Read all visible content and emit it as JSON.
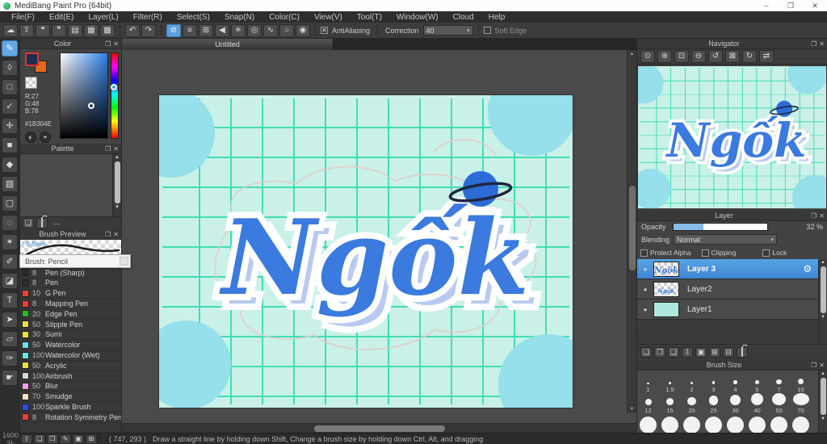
{
  "window": {
    "title": "MediBang Paint Pro (64bit)"
  },
  "icons": {
    "minimize": "–",
    "maximize": "❐",
    "close": "✕",
    "panel_float": "❐",
    "panel_close": "✕",
    "scroll_up": "▲",
    "scroll_down": "▼",
    "gear": "⚙",
    "dropdown": "▾",
    "visibility": "●",
    "check": "✕",
    "dash": "—"
  },
  "menu": {
    "items": [
      "File(F)",
      "Edit(E)",
      "Layer(L)",
      "Filter(R)",
      "Select(S)",
      "Snap(N)",
      "Color(C)",
      "View(V)",
      "Tool(T)",
      "Window(W)",
      "Cloud",
      "Help"
    ]
  },
  "toolbar": {
    "file_buttons": [
      {
        "name": "cloud-save-button",
        "glyph": "☁"
      },
      {
        "name": "upload-button",
        "glyph": "⇧"
      },
      {
        "name": "comment-button",
        "glyph": "❝"
      },
      {
        "name": "chat-button",
        "glyph": "❞"
      },
      {
        "name": "document-button",
        "glyph": "▤"
      },
      {
        "name": "layout-panels-button",
        "glyph": "▦"
      },
      {
        "name": "tile-panels-button",
        "glyph": "▩"
      }
    ],
    "history_buttons": [
      {
        "name": "undo-button",
        "glyph": "↶"
      },
      {
        "name": "redo-button",
        "glyph": "↷"
      }
    ],
    "snap_buttons": [
      {
        "name": "snap-off-button",
        "glyph": "⊘",
        "selected": true
      },
      {
        "name": "parallel-snap-button",
        "glyph": "≡"
      },
      {
        "name": "cross-snap-button",
        "glyph": "⊞"
      },
      {
        "name": "vanishing-point-snap-button",
        "glyph": "◀"
      },
      {
        "name": "radial-snap-button",
        "glyph": "✳"
      },
      {
        "name": "concentric-circle-snap-button",
        "glyph": "◎"
      },
      {
        "name": "curve-snap-button",
        "glyph": "∿"
      },
      {
        "name": "ellipse-snap-button",
        "glyph": "○"
      },
      {
        "name": "snap-settings-button",
        "glyph": "◉"
      }
    ],
    "antialiasing_label": "AntiAliasing",
    "correction_label": "Correction",
    "correction_value": "40",
    "soft_edge_label": "Soft Edge"
  },
  "tools": [
    {
      "name": "tool-brush",
      "glyph": "✎",
      "selected": true
    },
    {
      "name": "tool-eraser",
      "glyph": "◊"
    },
    {
      "name": "tool-shape-brush",
      "glyph": "□"
    },
    {
      "name": "tool-dot-pen",
      "glyph": "✓"
    },
    {
      "name": "tool-move",
      "glyph": "✛"
    },
    {
      "name": "tool-fill-rect",
      "glyph": "■"
    },
    {
      "name": "tool-bucket",
      "glyph": "◆"
    },
    {
      "name": "tool-gradient",
      "glyph": "▧"
    },
    {
      "name": "tool-select",
      "glyph": "▢"
    },
    {
      "name": "tool-lasso",
      "glyph": "◌"
    },
    {
      "name": "tool-magic-wand",
      "glyph": "✶"
    },
    {
      "name": "tool-select-pen",
      "glyph": "✐"
    },
    {
      "name": "tool-select-eraser",
      "glyph": "◪"
    },
    {
      "name": "tool-text",
      "glyph": "T"
    },
    {
      "name": "tool-operation",
      "glyph": "➤"
    },
    {
      "name": "tool-eraser-soft",
      "glyph": "▱"
    },
    {
      "name": "tool-eyedropper",
      "glyph": "✑"
    },
    {
      "name": "tool-hand",
      "glyph": "☛"
    }
  ],
  "color_panel": {
    "title": "Color",
    "r": "R:27",
    "g": "G:48",
    "b": "B:78",
    "hex": "#1B304E",
    "fg_color": "#1b304e",
    "bg_color": "#e8671c",
    "buttons": [
      {
        "name": "color-wheel-button",
        "glyph": "◐"
      },
      {
        "name": "color-mode-button",
        "glyph": "◓"
      }
    ]
  },
  "palette_panel": {
    "title": "Palette",
    "empty_label": "—"
  },
  "brush_preview": {
    "title": "Brush Preview",
    "size_label": "* 0.5mm",
    "tooltip": "Brush: Pencil"
  },
  "brushes": {
    "items": [
      {
        "size": "7",
        "name": "Pencil",
        "color": "#2a2a2a",
        "selected": true
      },
      {
        "size": "8",
        "name": "Pen (Sharp)",
        "color": "#2a2a2a"
      },
      {
        "size": "8",
        "name": "Pen",
        "color": "#2a2a2a"
      },
      {
        "size": "10",
        "name": "G Pen",
        "color": "#e8413c"
      },
      {
        "size": "8",
        "name": "Mapping Pen",
        "color": "#e8413c"
      },
      {
        "size": "20",
        "name": "Edge Pen",
        "color": "#2fb52f"
      },
      {
        "size": "50",
        "name": "Stipple Pen",
        "color": "#e8e23c"
      },
      {
        "size": "30",
        "name": "Sumi",
        "color": "#e8e23c"
      },
      {
        "size": "50",
        "name": "Watercolor",
        "color": "#6fe0e8"
      },
      {
        "size": "100",
        "name": "Watercolor (Wet)",
        "color": "#6fe0e8"
      },
      {
        "size": "50",
        "name": "Acrylic",
        "color": "#e8e23c"
      },
      {
        "size": "100",
        "name": "Airbrush",
        "color": "#d8d8d8"
      },
      {
        "size": "50",
        "name": "Blur",
        "color": "#f0a0e8"
      },
      {
        "size": "70",
        "name": "Smudge",
        "color": "#f8dfc8"
      },
      {
        "size": "100",
        "name": "Sparkle Brush",
        "color": "#2f4fe0"
      },
      {
        "size": "8",
        "name": "Rotation Symmetry Pen",
        "color": "#e8413c"
      }
    ]
  },
  "canvas": {
    "tab_title": "Untitled",
    "artwork_text": "Ngốk"
  },
  "navigator": {
    "title": "Navigator",
    "buttons": [
      {
        "name": "nav-zoom-button",
        "glyph": "⊙"
      },
      {
        "name": "nav-zoom-in-button",
        "glyph": "⊕"
      },
      {
        "name": "nav-fit-screen-button",
        "glyph": "⊡"
      },
      {
        "name": "nav-zoom-out-button",
        "glyph": "⊖"
      },
      {
        "name": "nav-rotate-left-button",
        "glyph": "↺"
      },
      {
        "name": "nav-reset-view-button",
        "glyph": "⊠"
      },
      {
        "name": "nav-rotate-right-button",
        "glyph": "↻"
      },
      {
        "name": "nav-flip-button",
        "glyph": "⇄"
      }
    ]
  },
  "layer_panel": {
    "title": "Layer",
    "opacity_label": "Opacity",
    "opacity_value": "32 %",
    "opacity_percent": 32,
    "blending_label": "Blending",
    "blending_value": "Normal",
    "check_labels": [
      "Protect Alpha",
      "Clipping",
      "Lock"
    ],
    "layers": [
      {
        "name": "Layer 3",
        "thumb": "l3",
        "selected": true
      },
      {
        "name": "Layer2",
        "thumb": "l2"
      },
      {
        "name": "Layer1",
        "thumb": "l1"
      }
    ],
    "buttons": [
      {
        "name": "new-layer-button",
        "glyph": "❏"
      },
      {
        "name": "new-8bit-layer-button",
        "glyph": "❐"
      },
      {
        "name": "new-1bit-layer-button",
        "glyph": "❑"
      },
      {
        "name": "import-layer-button",
        "glyph": "⇩"
      },
      {
        "name": "layer-folder-button",
        "glyph": "▣"
      },
      {
        "name": "duplicate-layer-button",
        "glyph": "⊞"
      },
      {
        "name": "merge-layer-button",
        "glyph": "⊟"
      },
      {
        "name": "delete-layer-button",
        "glyph": ""
      }
    ]
  },
  "brush_size_panel": {
    "title": "Brush Size",
    "row1": [
      "1",
      "1.5",
      "2",
      "3",
      "4",
      "5",
      "7",
      "10"
    ],
    "row2": [
      "12",
      "15",
      "20",
      "25",
      "30",
      "40",
      "50",
      "70"
    ]
  },
  "status_bar": {
    "zoom": "1600 %",
    "buttons": [
      {
        "name": "upload-brush-button",
        "glyph": "⇧"
      },
      {
        "name": "new-brush-button",
        "glyph": "❏"
      },
      {
        "name": "new-brush-menu-button",
        "glyph": "❐"
      },
      {
        "name": "edit-brush-button",
        "glyph": "✎"
      },
      {
        "name": "brush-folder-button",
        "glyph": "▣"
      },
      {
        "name": "duplicate-brush-button",
        "glyph": "⊞"
      }
    ],
    "coordinates": "( 747, 293 )",
    "hint": "Draw a straight line by holding down Shift, Change a brush size by holding down Ctrl, Alt, and dragging"
  },
  "colors": {
    "accent": "#4d9fdb",
    "foreground": "#1b304e",
    "background_swatch": "#e8671c",
    "canvas_mint": "#c9f1e8",
    "grid_teal": "#41ddb5",
    "circle_cyan": "#95e0ea",
    "planet_blue": "#2d6cd6",
    "lettering_blue": "#3b7ade",
    "lettering_shadow": "#b9c9f0"
  }
}
